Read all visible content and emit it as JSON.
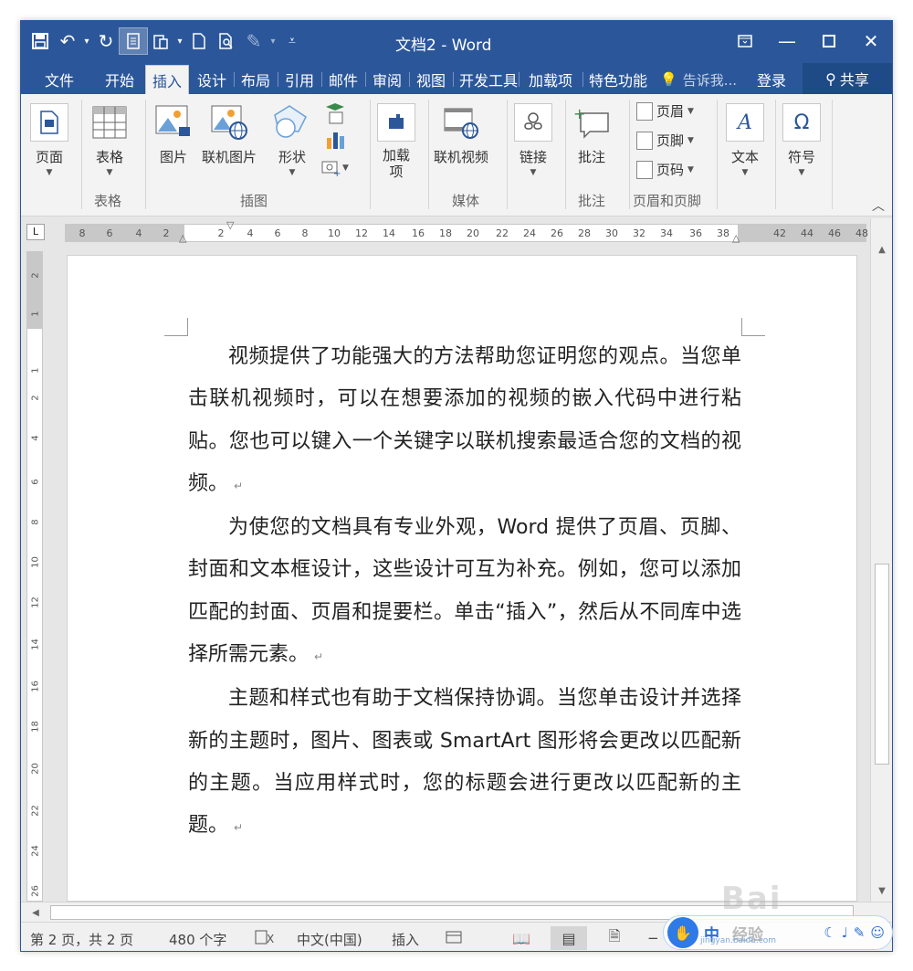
{
  "window": {
    "title": "文档2 - Word"
  },
  "qat": {
    "save_icon": "save-icon",
    "undo_icon": "undo-icon",
    "redo_icon": "redo-icon",
    "page_view_icon": "document-icon",
    "paste_icon": "paste-icon",
    "new_icon": "new-doc-icon",
    "preview_icon": "print-preview-icon",
    "draw_icon": "pen-icon",
    "customize_icon": "more-icon"
  },
  "tabs": [
    {
      "label": "文件"
    },
    {
      "label": "开始"
    },
    {
      "label": "插入"
    },
    {
      "label": "设计"
    },
    {
      "label": "布局"
    },
    {
      "label": "引用"
    },
    {
      "label": "邮件"
    },
    {
      "label": "审阅"
    },
    {
      "label": "视图"
    },
    {
      "label": "开发工具"
    },
    {
      "label": "加载项"
    },
    {
      "label": "特色功能"
    }
  ],
  "tell_me": "告诉我...",
  "login": "登录",
  "share": "共享",
  "ribbon": {
    "page": "页面",
    "table": "表格",
    "picture": "图片",
    "online_picture": "联机图片",
    "shapes": "形状",
    "addins": "加载\n项",
    "online_video": "联机视频",
    "link": "链接",
    "comment": "批注",
    "header": "页眉",
    "footer": "页脚",
    "page_number": "页码",
    "text": "文本",
    "symbol": "符号",
    "groups": {
      "table": "表格",
      "illustrations": "插图",
      "media": "媒体",
      "comments": "批注",
      "header_footer": "页眉和页脚"
    }
  },
  "ruler": {
    "ticks": [
      "8",
      "6",
      "4",
      "2",
      "2",
      "4",
      "6",
      "8",
      "10",
      "12",
      "14",
      "16",
      "18",
      "20",
      "22",
      "24",
      "26",
      "28",
      "30",
      "32",
      "34",
      "36",
      "38",
      "42",
      "44",
      "46",
      "48"
    ],
    "vticks": [
      "2",
      "1",
      "1",
      "2",
      "4",
      "6",
      "8",
      "10",
      "12",
      "14",
      "16",
      "18",
      "20",
      "22",
      "24",
      "26"
    ]
  },
  "document": {
    "paragraphs": [
      "视频提供了功能强大的方法帮助您证明您的观点。当您单击联机视频时，可以在想要添加的视频的嵌入代码中进行粘贴。您也可以键入一个关键字以联机搜索最适合您的文档的视频。",
      "为使您的文档具有专业外观，Word 提供了页眉、页脚、封面和文本框设计，这些设计可互为补充。例如，您可以添加匹配的封面、页眉和提要栏。单击“插入”，然后从不同库中选择所需元素。",
      "主题和样式也有助于文档保持协调。当您单击设计并选择新的主题时，图片、图表或 SmartArt 图形将会更改以匹配新的主题。当应用样式时，您的标题会进行更改以匹配新的主题。"
    ],
    "pilcrow": "↵"
  },
  "status": {
    "page": "第 2 页，共 2 页",
    "words": "480 个字",
    "lang": "中文(中国)",
    "mode": "插入"
  },
  "watermark": {
    "brand": "Bai",
    "text": "经验",
    "sub": "jingyan.baidu.com",
    "badge": "中"
  },
  "colors": {
    "accent": "#2b579a"
  }
}
